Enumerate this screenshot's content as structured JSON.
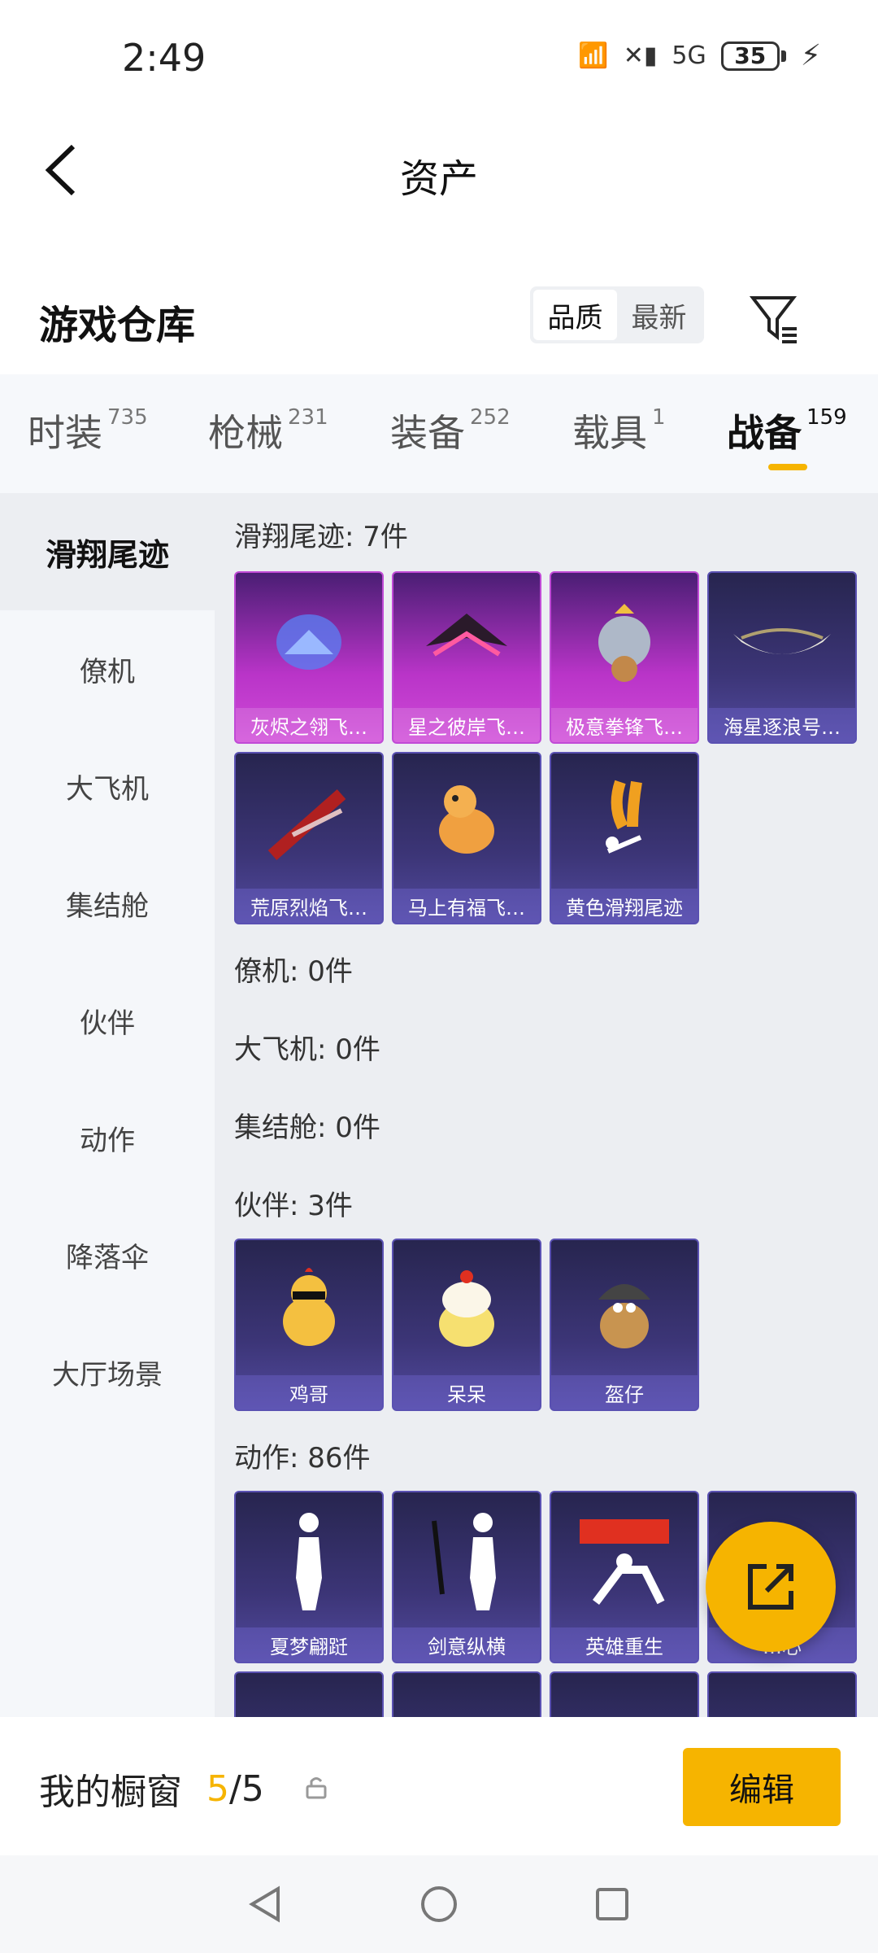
{
  "status": {
    "time": "2:49",
    "battery": "35",
    "network": "5G"
  },
  "topbar": {
    "title": "资产"
  },
  "warehouse": {
    "title": "游戏仓库",
    "sort_options": [
      "品质",
      "最新"
    ],
    "active_sort": "品质"
  },
  "tabs": [
    {
      "label": "时装",
      "count": "735"
    },
    {
      "label": "枪械",
      "count": "231"
    },
    {
      "label": "装备",
      "count": "252"
    },
    {
      "label": "载具",
      "count": "1"
    },
    {
      "label": "战备",
      "count": "159"
    }
  ],
  "sidebar": {
    "items": [
      "滑翔尾迹",
      "僚机",
      "大飞机",
      "集结舱",
      "伙伴",
      "动作",
      "降落伞",
      "大厅场景"
    ]
  },
  "sections": {
    "glide": {
      "title": "滑翔尾迹: 7件",
      "items": [
        "灰烬之翎飞…",
        "星之彼岸飞…",
        "极意拳锋飞…",
        "海星逐浪号…",
        "荒原烈焰飞…",
        "马上有福飞…",
        "黄色滑翔尾迹"
      ]
    },
    "wingman": {
      "title": "僚机: 0件"
    },
    "plane": {
      "title": "大飞机: 0件"
    },
    "pod": {
      "title": "集结舱: 0件"
    },
    "partner": {
      "title": "伙伴: 3件",
      "items": [
        "鸡哥",
        "呆呆",
        "盔仔"
      ]
    },
    "action": {
      "title": "动作: 86件",
      "items": [
        "夏梦翩跹",
        "剑意纵横",
        "英雄重生",
        "…心"
      ]
    }
  },
  "bottom": {
    "label": "我的橱窗",
    "current": "5",
    "total": "/5",
    "edit_label": "编辑"
  },
  "colors": {
    "accent": "#f6b400",
    "rare_purple": "#b934c8",
    "rare_blue": "#3c3577"
  }
}
